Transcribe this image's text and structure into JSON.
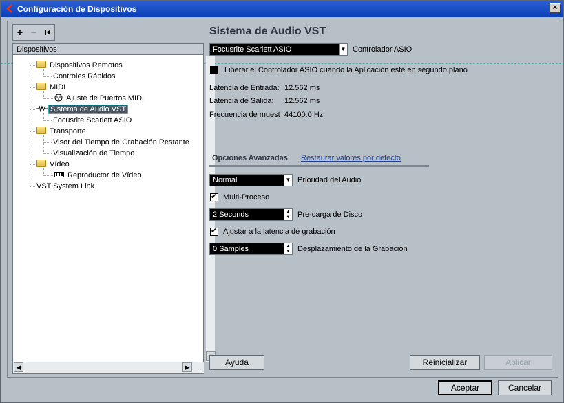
{
  "window": {
    "title": "Configuración de Dispositivos",
    "close_label": "×"
  },
  "toolbar": {
    "add_label": "+",
    "remove_label": "−",
    "reset_label": "⏮"
  },
  "tree": {
    "header": "Dispositivos",
    "items": [
      {
        "label": "Dispositivos Remotos"
      },
      {
        "label": "Controles Rápidos"
      },
      {
        "label": "MIDI"
      },
      {
        "label": "Ajuste de Puertos MIDI"
      },
      {
        "label": "Sistema de Audio VST"
      },
      {
        "label": "Focusrite Scarlett ASIO"
      },
      {
        "label": "Transporte"
      },
      {
        "label": "Visor del Tiempo de Grabación Restante"
      },
      {
        "label": "Visualización de Tiempo"
      },
      {
        "label": "Vídeo"
      },
      {
        "label": "Reproductor de Vídeo"
      },
      {
        "label": "VST System Link"
      }
    ]
  },
  "main": {
    "heading": "Sistema de Audio VST",
    "driver_select": {
      "value": "Focusrite Scarlett ASIO",
      "label": "Controlador ASIO"
    },
    "release_checkbox": {
      "checked": false,
      "label": "Liberar el Controlador ASIO cuando la Aplicación esté en segundo plano"
    },
    "info": [
      {
        "label": "Latencia de Entrada:",
        "value": "12.562 ms"
      },
      {
        "label": "Latencia de Salida:",
        "value": "12.562 ms"
      },
      {
        "label": "Frecuencia de muest",
        "value": "44100.0 Hz"
      }
    ],
    "advanced": {
      "title": "Opciones Avanzadas",
      "restore_link": "Restaurar valores por defecto",
      "priority": {
        "value": "Normal",
        "label": "Prioridad del Audio"
      },
      "multiprocess": {
        "checked": true,
        "label": "Multi-Proceso"
      },
      "preload": {
        "value": "2 Seconds",
        "label": "Pre-carga de Disco"
      },
      "adjust_latency": {
        "checked": true,
        "label": "Ajustar a la latencia de grabación"
      },
      "offset": {
        "value": "0 Samples",
        "label": "Desplazamiento de la Grabación"
      }
    }
  },
  "buttons": {
    "help": "Ayuda",
    "reset": "Reinicializar",
    "apply": "Aplicar",
    "accept": "Aceptar",
    "cancel": "Cancelar"
  }
}
